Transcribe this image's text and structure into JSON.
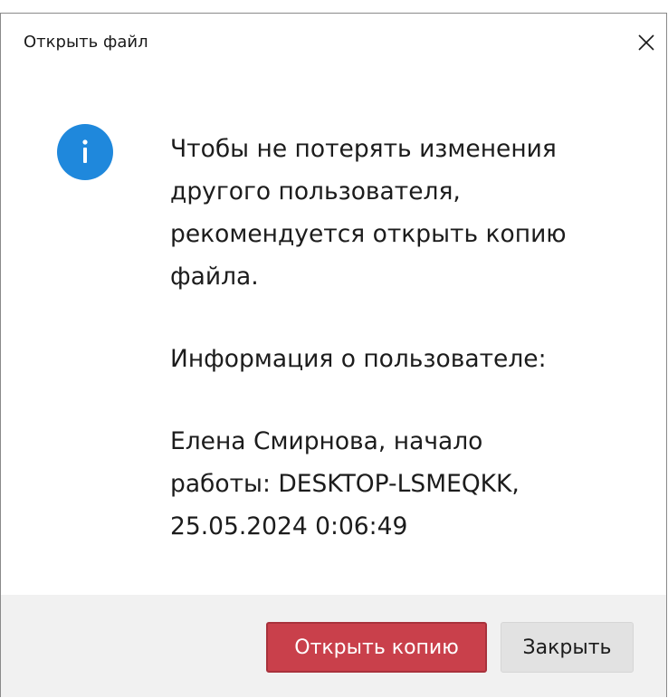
{
  "dialog": {
    "title": "Открыть файл",
    "close_icon": "close-icon",
    "info_icon": "info-icon",
    "info_icon_color": "#1f88dc",
    "message": {
      "line1": "Чтобы не потерять изменения",
      "line2": "другого пользователя,",
      "line3": "рекомендуется открыть копию",
      "line4": "файла.",
      "user_info_label": "Информация о пользователе:",
      "user_line1": "Елена Смирнова, начало",
      "user_line2": "работы: DESKTOP-LSMEQKK,",
      "user_line3": "25.05.2024 0:06:49"
    },
    "buttons": {
      "open_copy": "Открыть копию",
      "close": "Закрыть"
    },
    "primary_button_color": "#c9404b"
  }
}
